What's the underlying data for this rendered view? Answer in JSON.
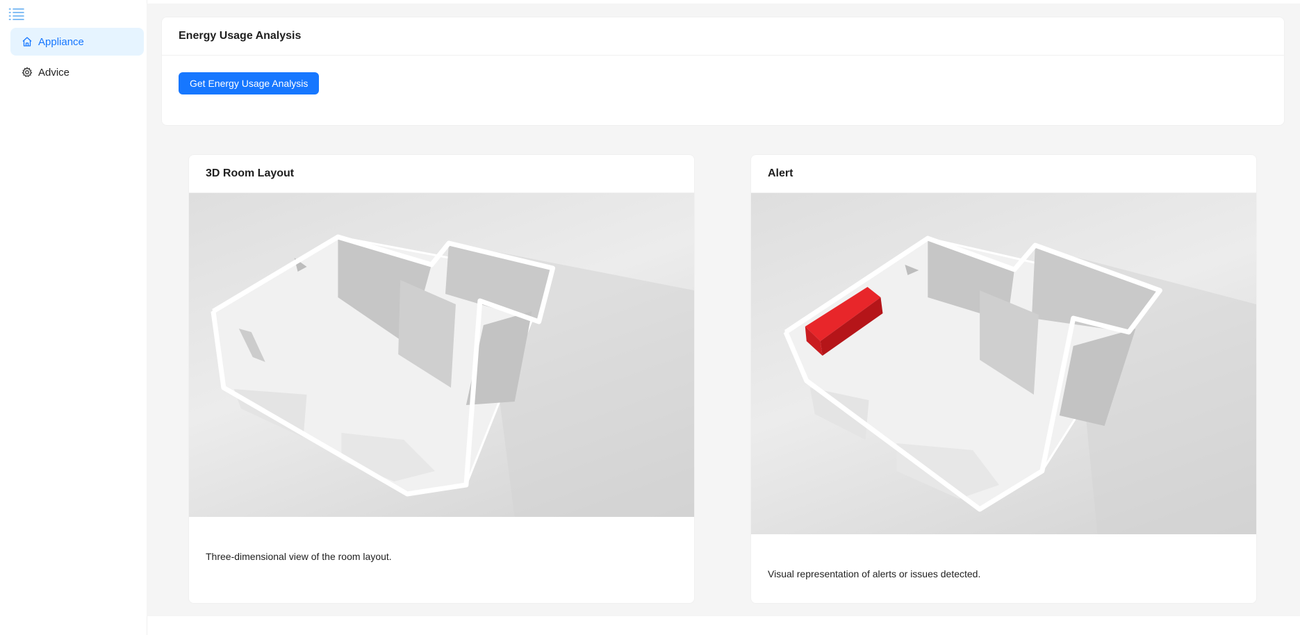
{
  "sidebar": {
    "items": [
      {
        "label": "Appliance",
        "icon": "home-icon",
        "active": true
      },
      {
        "label": "Advice",
        "icon": "gear-icon",
        "active": false
      }
    ]
  },
  "analysis_card": {
    "title": "Energy Usage Analysis",
    "button_label": "Get Energy Usage Analysis"
  },
  "room_card": {
    "title": "3D Room Layout",
    "description": "Three-dimensional view of the room layout."
  },
  "alert_card": {
    "title": "Alert",
    "description": "Visual representation of alerts or issues detected."
  },
  "colors": {
    "accent": "#1677ff",
    "alert": "#e8262a",
    "active_bg": "#e6f4ff"
  }
}
